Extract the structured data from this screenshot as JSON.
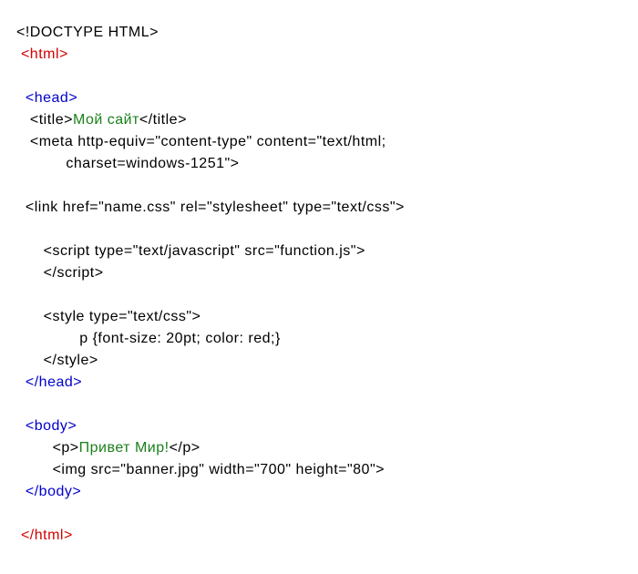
{
  "lines": [
    {
      "indent": 0,
      "segs": [
        {
          "cls": "blk",
          "text": "<!DOCTYPE HTML>"
        }
      ]
    },
    {
      "indent": 1,
      "segs": [
        {
          "cls": "red",
          "text": "<html>"
        }
      ]
    },
    {
      "indent": 0,
      "segs": []
    },
    {
      "indent": 2,
      "segs": [
        {
          "cls": "blu",
          "text": "<head>"
        }
      ]
    },
    {
      "indent": 3,
      "segs": [
        {
          "cls": "blk",
          "text": "<title>"
        },
        {
          "cls": "grn",
          "text": "Мой сайт"
        },
        {
          "cls": "blk",
          "text": "</title>"
        }
      ]
    },
    {
      "indent": 3,
      "segs": [
        {
          "cls": "blk",
          "text": "<meta http-equiv=\"content-type\" content=\"text/html;"
        }
      ]
    },
    {
      "indent": 11,
      "segs": [
        {
          "cls": "blk",
          "text": "charset=windows-1251\">"
        }
      ]
    },
    {
      "indent": 0,
      "segs": []
    },
    {
      "indent": 2,
      "segs": [
        {
          "cls": "blk",
          "text": "<link href=\"name.css\" rel=\"stylesheet\" type=\"text/css\">"
        }
      ]
    },
    {
      "indent": 0,
      "segs": []
    },
    {
      "indent": 6,
      "segs": [
        {
          "cls": "blk",
          "text": "<script type=\"text/javascript\" src=\"function.js\">"
        }
      ]
    },
    {
      "indent": 6,
      "segs": [
        {
          "cls": "blk",
          "text": "</script>"
        }
      ]
    },
    {
      "indent": 0,
      "segs": []
    },
    {
      "indent": 6,
      "segs": [
        {
          "cls": "blk",
          "text": "<style type=\"text/css\">"
        }
      ]
    },
    {
      "indent": 14,
      "segs": [
        {
          "cls": "blk",
          "text": "p {font-size: 20pt; color: red;}"
        }
      ]
    },
    {
      "indent": 6,
      "segs": [
        {
          "cls": "blk",
          "text": "</style>"
        }
      ]
    },
    {
      "indent": 2,
      "segs": [
        {
          "cls": "blu",
          "text": "</head>"
        }
      ]
    },
    {
      "indent": 0,
      "segs": []
    },
    {
      "indent": 2,
      "segs": [
        {
          "cls": "blu",
          "text": "<body>"
        }
      ]
    },
    {
      "indent": 8,
      "segs": [
        {
          "cls": "blk",
          "text": "<p>"
        },
        {
          "cls": "grn",
          "text": "Привет Мир!"
        },
        {
          "cls": "blk",
          "text": "</p>"
        }
      ]
    },
    {
      "indent": 8,
      "segs": [
        {
          "cls": "blk",
          "text": "<img src=\"banner.jpg\" width=\"700\" height=\"80\">"
        }
      ]
    },
    {
      "indent": 2,
      "segs": [
        {
          "cls": "blu",
          "text": "</body>"
        }
      ]
    },
    {
      "indent": 0,
      "segs": []
    },
    {
      "indent": 1,
      "segs": [
        {
          "cls": "red",
          "text": "</html>"
        }
      ]
    }
  ],
  "colors": {
    "black": "#000000",
    "red": "#d40000",
    "blue": "#0000cc",
    "green": "#1a7f1a"
  }
}
